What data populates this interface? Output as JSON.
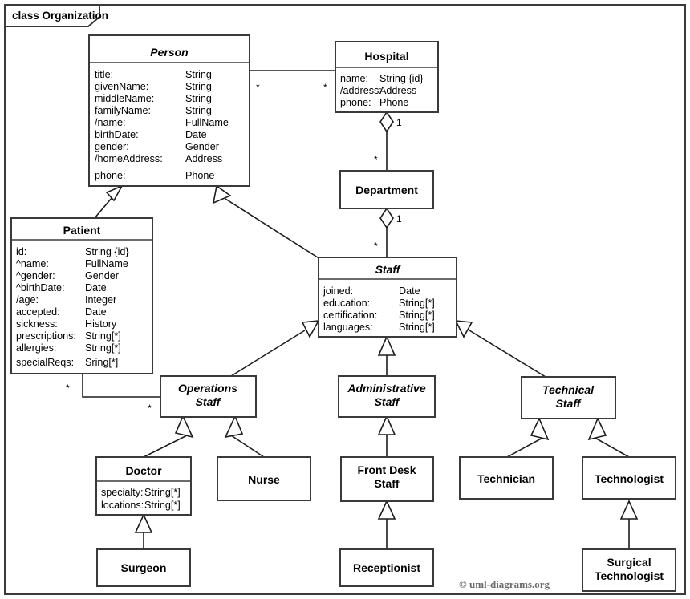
{
  "frame": {
    "label": "class Organization"
  },
  "credit": "© uml-diagrams.org",
  "colors": {
    "box_stroke": "#3a3a3a",
    "line": "#1d1d1d",
    "background": "#ffffff",
    "credit_text": "#6b6b6b"
  },
  "classes": {
    "person": {
      "name": "Person",
      "abstract": true,
      "attributes": [
        {
          "name": "title:",
          "type": "String"
        },
        {
          "name": "givenName:",
          "type": "String"
        },
        {
          "name": "middleName:",
          "type": "String"
        },
        {
          "name": "familyName:",
          "type": "String"
        },
        {
          "name": "/name:",
          "type": "FullName"
        },
        {
          "name": "birthDate:",
          "type": "Date"
        },
        {
          "name": "gender:",
          "type": "Gender"
        },
        {
          "name": "/homeAddress:",
          "type": "Address"
        },
        {
          "name": "phone:",
          "type": "Phone"
        }
      ]
    },
    "hospital": {
      "name": "Hospital",
      "abstract": false,
      "attributes": [
        {
          "name": "name:",
          "type": "String {id}"
        },
        {
          "name": "/address:",
          "type": "Address"
        },
        {
          "name": "phone:",
          "type": "Phone"
        }
      ]
    },
    "department": {
      "name": "Department",
      "abstract": false,
      "attributes": []
    },
    "patient": {
      "name": "Patient",
      "abstract": false,
      "attributes": [
        {
          "name": "id:",
          "type": "String {id}"
        },
        {
          "name": "^name:",
          "type": "FullName"
        },
        {
          "name": "^gender:",
          "type": "Gender"
        },
        {
          "name": "^birthDate:",
          "type": "Date"
        },
        {
          "name": "/age:",
          "type": "Integer"
        },
        {
          "name": "accepted:",
          "type": "Date"
        },
        {
          "name": "sickness:",
          "type": "History"
        },
        {
          "name": "prescriptions:",
          "type": "String[*]"
        },
        {
          "name": "allergies:",
          "type": "String[*]"
        },
        {
          "name": "specialReqs:",
          "type": "Sring[*]"
        }
      ]
    },
    "staff": {
      "name": "Staff",
      "abstract": true,
      "attributes": [
        {
          "name": "joined:",
          "type": "Date"
        },
        {
          "name": "education:",
          "type": "String[*]"
        },
        {
          "name": "certification:",
          "type": "String[*]"
        },
        {
          "name": "languages:",
          "type": "String[*]"
        }
      ]
    },
    "operations_staff": {
      "name_line1": "Operations",
      "name_line2": "Staff",
      "abstract": true
    },
    "administrative_staff": {
      "name_line1": "Administrative",
      "name_line2": "Staff",
      "abstract": true
    },
    "technical_staff": {
      "name_line1": "Technical",
      "name_line2": "Staff",
      "abstract": true
    },
    "doctor": {
      "name": "Doctor",
      "abstract": false,
      "attributes": [
        {
          "name": "specialty:",
          "type": "String[*]"
        },
        {
          "name": "locations:",
          "type": "String[*]"
        }
      ]
    },
    "nurse": {
      "name": "Nurse",
      "abstract": false
    },
    "front_desk_staff": {
      "name_line1": "Front Desk",
      "name_line2": "Staff",
      "abstract": false
    },
    "technician": {
      "name": "Technician",
      "abstract": false
    },
    "technologist": {
      "name": "Technologist",
      "abstract": false
    },
    "surgeon": {
      "name": "Surgeon",
      "abstract": false
    },
    "receptionist": {
      "name": "Receptionist",
      "abstract": false
    },
    "surgical_technologist": {
      "name_line1": "Surgical",
      "name_line2": "Technologist",
      "abstract": false
    }
  },
  "multiplicities": {
    "person_hospital_person_end": "*",
    "person_hospital_hospital_end": "*",
    "hospital_department_hospital_end": "1",
    "hospital_department_department_end": "*",
    "department_staff_department_end": "1",
    "department_staff_staff_end": "*",
    "patient_operations_patient_end": "*",
    "patient_operations_staff_end": "*"
  },
  "relationships": [
    {
      "kind": "association",
      "from": "person",
      "to": "hospital"
    },
    {
      "kind": "aggregation",
      "whole": "hospital",
      "part": "department"
    },
    {
      "kind": "aggregation",
      "whole": "department",
      "part": "staff"
    },
    {
      "kind": "association",
      "from": "patient",
      "to": "operations_staff"
    },
    {
      "kind": "generalization",
      "child": "patient",
      "parent": "person"
    },
    {
      "kind": "generalization",
      "child": "staff",
      "parent": "person"
    },
    {
      "kind": "generalization",
      "child": "operations_staff",
      "parent": "staff"
    },
    {
      "kind": "generalization",
      "child": "administrative_staff",
      "parent": "staff"
    },
    {
      "kind": "generalization",
      "child": "technical_staff",
      "parent": "staff"
    },
    {
      "kind": "generalization",
      "child": "doctor",
      "parent": "operations_staff"
    },
    {
      "kind": "generalization",
      "child": "nurse",
      "parent": "operations_staff"
    },
    {
      "kind": "generalization",
      "child": "front_desk_staff",
      "parent": "administrative_staff"
    },
    {
      "kind": "generalization",
      "child": "technician",
      "parent": "technical_staff"
    },
    {
      "kind": "generalization",
      "child": "technologist",
      "parent": "technical_staff"
    },
    {
      "kind": "generalization",
      "child": "surgeon",
      "parent": "doctor"
    },
    {
      "kind": "generalization",
      "child": "receptionist",
      "parent": "front_desk_staff"
    },
    {
      "kind": "generalization",
      "child": "surgical_technologist",
      "parent": "technologist"
    }
  ]
}
